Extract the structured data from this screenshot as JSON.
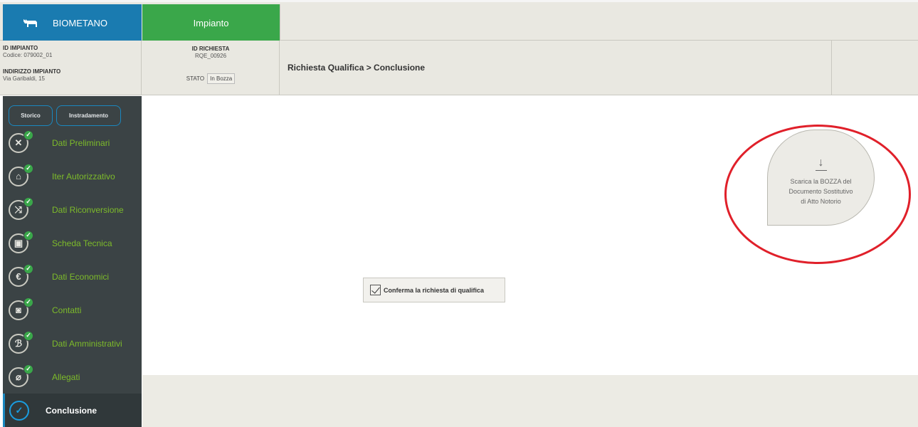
{
  "header": {
    "brand_label": "BIOMETANO",
    "tab_label": "Impianto"
  },
  "info": {
    "id_impianto_label": "ID IMPIANTO",
    "codice": "Codice: 079002_01",
    "indirizzo_label": "INDIRIZZO IMPIANTO",
    "indirizzo": "Via Garibaldi, 15",
    "id_richiesta_label": "ID RICHIESTA",
    "id_richiesta": "RQE_00926",
    "stato_label": "STATO",
    "stato_value": "In Bozza",
    "breadcrumb": "Richiesta Qualifica > Conclusione"
  },
  "sidebar": {
    "pills": [
      "Storico",
      "Instradamento"
    ],
    "items": [
      {
        "label": "Dati Preliminari",
        "icon": "tools-icon",
        "glyph": "✕"
      },
      {
        "label": "Iter Autorizzativo",
        "icon": "factory-icon",
        "glyph": "⌂"
      },
      {
        "label": "Dati Riconversione",
        "icon": "shuffle-icon",
        "glyph": "⤨"
      },
      {
        "label": "Scheda Tecnica",
        "icon": "wallet-icon",
        "glyph": "▣"
      },
      {
        "label": "Dati Economici",
        "icon": "euro-icon",
        "glyph": "€"
      },
      {
        "label": "Contatti",
        "icon": "contact-icon",
        "glyph": "◙"
      },
      {
        "label": "Dati Amministrativi",
        "icon": "wrench-icon",
        "glyph": "ℬ"
      },
      {
        "label": "Allegati",
        "icon": "paperclip-icon",
        "glyph": "⌀"
      }
    ],
    "active_label": "Conclusione",
    "check_glyph": "✓"
  },
  "main": {
    "download_line1": "Scarica la BOZZA del",
    "download_line2": "Documento Sostitutivo",
    "download_line3": "di Atto Notorio",
    "confirm_label": "Conferma la richiesta di qualifica"
  },
  "colors": {
    "brand": "#1a7bb0",
    "tab_green": "#3aa74a",
    "sidebar_bg": "#3b4345",
    "nav_label": "#7dbb2a",
    "highlight_ring": "#e0202a"
  }
}
